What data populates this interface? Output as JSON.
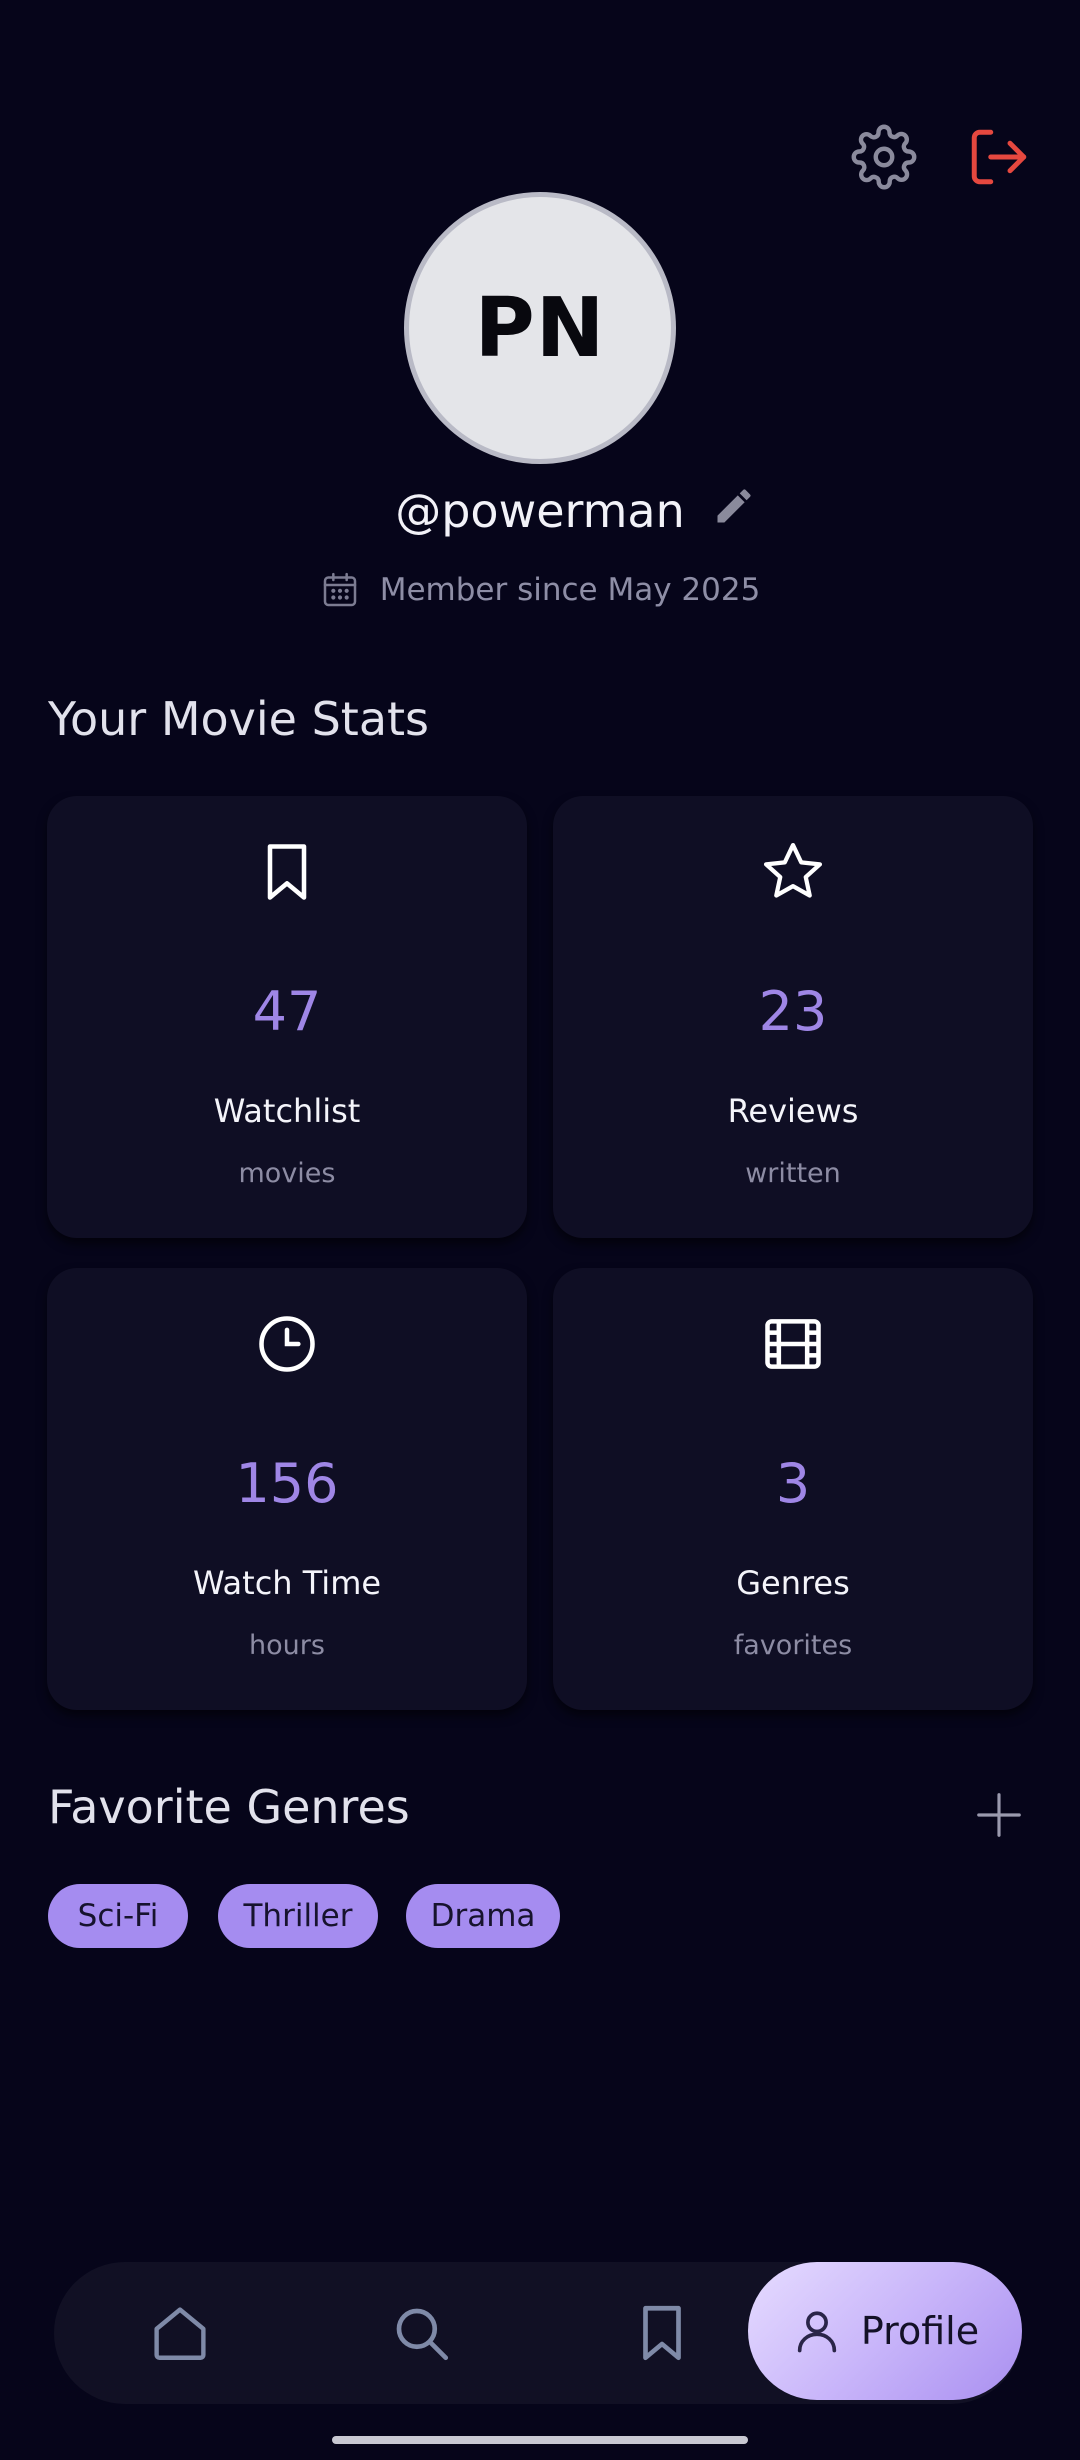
{
  "header": {
    "settings_icon": "gear-icon",
    "logout_icon": "logout-icon",
    "logout_color": "#e5483f"
  },
  "profile": {
    "initials": "PN",
    "username": "@powerman",
    "member_since": "Member since May 2025"
  },
  "stats": {
    "title": "Your Movie Stats",
    "cards": [
      {
        "icon": "bookmark-icon",
        "value": "47",
        "label": "Watchlist",
        "sub": "movies"
      },
      {
        "icon": "star-icon",
        "value": "23",
        "label": "Reviews",
        "sub": "written"
      },
      {
        "icon": "clock-icon",
        "value": "156",
        "label": "Watch Time",
        "sub": "hours"
      },
      {
        "icon": "film-icon",
        "value": "3",
        "label": "Genres",
        "sub": "favorites"
      }
    ]
  },
  "favorite_genres": {
    "title": "Favorite Genres",
    "add_icon": "plus-icon",
    "chips": [
      "Sci-Fi",
      "Thriller",
      "Drama"
    ]
  },
  "bottom_nav": {
    "items": [
      {
        "icon": "home-icon"
      },
      {
        "icon": "search-icon"
      },
      {
        "icon": "bookmark-icon"
      },
      {
        "icon": "user-icon",
        "label": "Profile",
        "active": true
      }
    ]
  },
  "colors": {
    "background": "#06051a",
    "card": "#0f0e24",
    "accent": "#a58cf0",
    "stat_value": "#9f86e6",
    "danger": "#e5483f"
  }
}
